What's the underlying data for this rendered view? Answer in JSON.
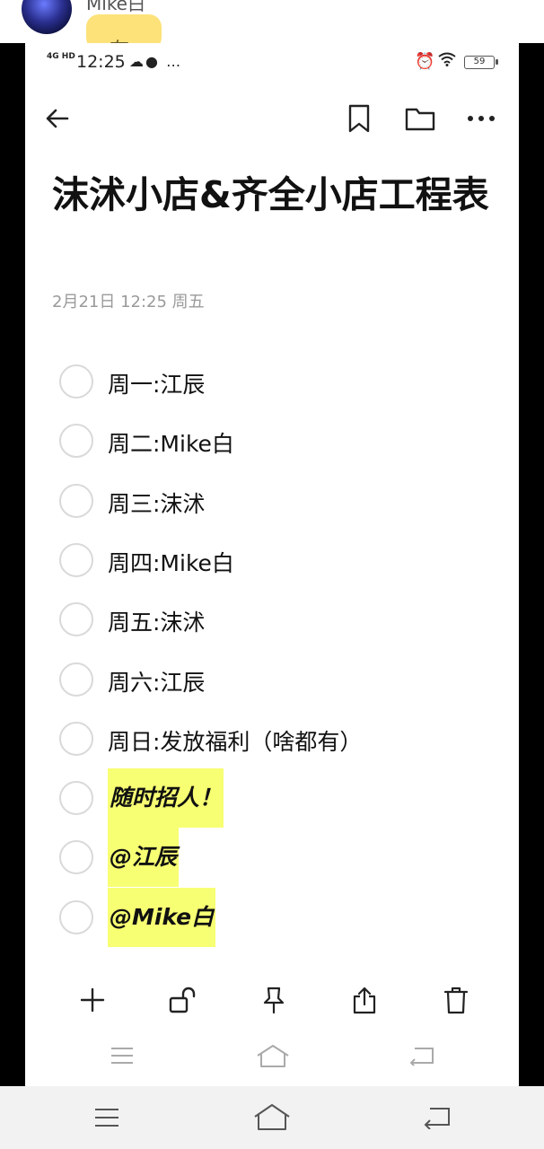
{
  "chat": {
    "sender_name": "Mike白",
    "bubble_text": "有"
  },
  "status_bar": {
    "network": "4G HD",
    "time": "12:25",
    "extra": "…",
    "battery": "59"
  },
  "note": {
    "title": "沫沭小店&齐全小店工程表",
    "date": "2月21日 12:25 周五",
    "items": [
      {
        "text": "周一:江辰",
        "highlight": false
      },
      {
        "text": "周二:Mike白",
        "highlight": false
      },
      {
        "text": "周三:沫沭",
        "highlight": false
      },
      {
        "text": "周四:Mike白",
        "highlight": false
      },
      {
        "text": "周五:沫沭",
        "highlight": false
      },
      {
        "text": "周六:江辰",
        "highlight": false
      },
      {
        "text": "周日:发放福利（啥都有）",
        "highlight": false
      },
      {
        "text": "随时招人！",
        "highlight": true
      },
      {
        "text": "@江辰",
        "highlight": true
      },
      {
        "text": "@Mike白",
        "highlight": true
      }
    ]
  },
  "colors": {
    "highlight": "#f7ff73",
    "checkbox_border": "#d9d9d9",
    "date_text": "#9a9a9a",
    "side_bars": "#000000"
  },
  "icons": {
    "toolbar": [
      "back-arrow-icon",
      "bookmark-icon",
      "folder-icon",
      "more-icon"
    ],
    "bottom": [
      "add-icon",
      "unlock-icon",
      "pin-icon",
      "share-icon",
      "trash-icon"
    ],
    "nav": [
      "menu-icon",
      "home-icon",
      "back-icon"
    ]
  }
}
